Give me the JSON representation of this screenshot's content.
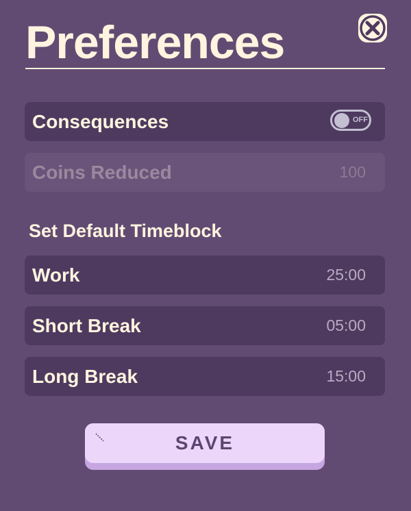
{
  "header": {
    "title": "Preferences",
    "close_icon": "close-x-icon"
  },
  "consequences": {
    "label": "Consequences",
    "toggle_state": "OFF"
  },
  "coins_reduced": {
    "label": "Coins Reduced",
    "value": "100"
  },
  "timeblock": {
    "heading": "Set Default Timeblock",
    "items": [
      {
        "label": "Work",
        "value": "25:00"
      },
      {
        "label": "Short Break",
        "value": "05:00"
      },
      {
        "label": "Long Break",
        "value": "15:00"
      }
    ]
  },
  "save": {
    "label": "SAVE"
  },
  "colors": {
    "background": "#624b72",
    "row": "#4e3a5f",
    "text": "#fff4df",
    "button": "#ecd7fb",
    "button_shadow": "#c6a5e0"
  }
}
